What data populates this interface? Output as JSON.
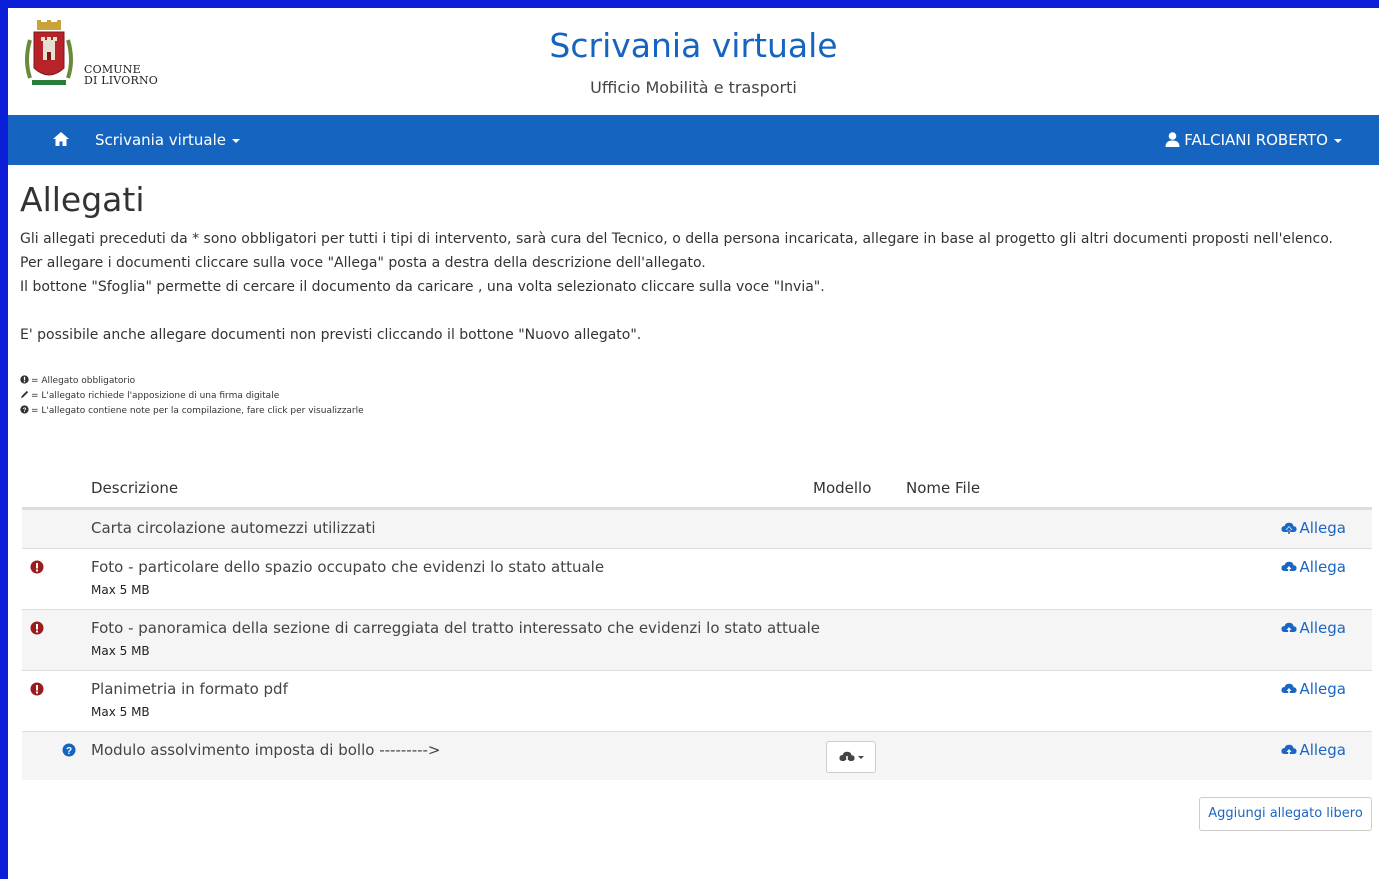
{
  "header": {
    "logo_line1": "Comune",
    "logo_line2": "di Livorno",
    "title": "Scrivania virtuale",
    "subtitle": "Ufficio Mobilità e trasporti"
  },
  "navbar": {
    "menu_label": "Scrivania virtuale",
    "user_name": "FALCIANI ROBERTO",
    "bg_color": "#1565c0"
  },
  "page": {
    "title": "Allegati",
    "intro": [
      "Gli allegati preceduti da * sono obbligatori per tutti i tipi di intervento, sarà cura del Tecnico, o della persona incaricata, allegare in base al progetto gli altri documenti proposti nell'elenco.",
      "Per allegare i documenti cliccare sulla voce \"Allega\" posta a destra della descrizione dell'allegato.",
      "Il bottone \"Sfoglia\" permette di cercare il documento da caricare , una volta selezionato cliccare sulla voce \"Invia\".",
      "E' possibile anche allegare documenti non previsti cliccando il bottone \"Nuovo allegato\"."
    ],
    "legend": [
      "= Allegato obbligatorio",
      "= L'allegato richiede l'apposizione di una firma digitale",
      "= L'allegato contiene note per la compilazione, fare click per visualizzarle"
    ]
  },
  "table": {
    "headers": {
      "description": "Descrizione",
      "model": "Modello",
      "file_name": "Nome File"
    },
    "rows": [
      {
        "description": "Carta circolazione automezzi utilizzati",
        "max": "",
        "action": "Allega"
      },
      {
        "description": "Foto - particolare dello spazio occupato che evidenzi lo stato attuale",
        "max": "Max 5 MB",
        "action": "Allega"
      },
      {
        "description": "Foto - panoramica della sezione di carreggiata del tratto interessato che evidenzi lo stato attuale",
        "max": "Max 5 MB",
        "action": "Allega"
      },
      {
        "description": "Planimetria in formato pdf",
        "max": "Max 5 MB",
        "action": "Allega"
      },
      {
        "description": "Modulo assolvimento imposta di bollo --------->",
        "max": "",
        "action": "Allega"
      }
    ]
  },
  "footer": {
    "add_free_label": "Aggiungi allegato libero"
  },
  "colors": {
    "link": "#1a66c4",
    "required": "#9b1c1c",
    "help": "#1565c0",
    "frame": "#0a1ed8"
  },
  "icons": [
    "home-icon",
    "user-icon",
    "exclamation-circle-icon",
    "pencil-icon",
    "question-circle-icon",
    "cloud-upload-icon"
  ]
}
